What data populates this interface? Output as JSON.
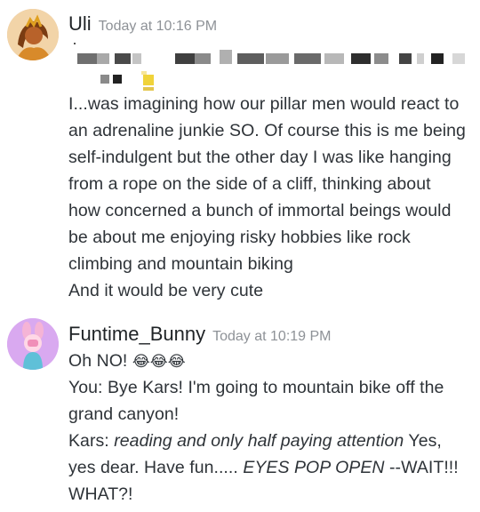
{
  "messages": [
    {
      "username": "Uli",
      "timestamp": "Today at 10:16 PM",
      "lines": [
        "I...was imagining how our pillar men would react to",
        "an adrenaline junkie SO. Of course this is me being",
        "self-indulgent but the other day I was like hanging",
        "from a rope on the side of a cliff, thinking about",
        "how concerned a bunch of immortal beings would",
        "be about me enjoying risky hobbies like rock",
        "climbing and mountain biking",
        "And it would be very cute"
      ]
    },
    {
      "username": "Funtime_Bunny",
      "timestamp": "Today at 10:19 PM",
      "greeting": "Oh NO!",
      "greeting_emoji": "😂😂😂",
      "line2": "You: Bye Kars! I'm going to mountain bike off the",
      "line3": "grand canyon!",
      "kars_label": "Kars:",
      "kars_action": "reading and only half paying attention",
      "kars_reply": "Yes,",
      "line5_text": "yes dear. Have fun.....",
      "line5_action": "EYES POP OPEN",
      "line5_tail": "--WAIT!!!",
      "line6": "WHAT?!"
    }
  ],
  "colors": {
    "username": "#1f2326",
    "timestamp": "#8e9297",
    "text": "#2e3338",
    "avatar2_bg": "#d9a9f0"
  }
}
